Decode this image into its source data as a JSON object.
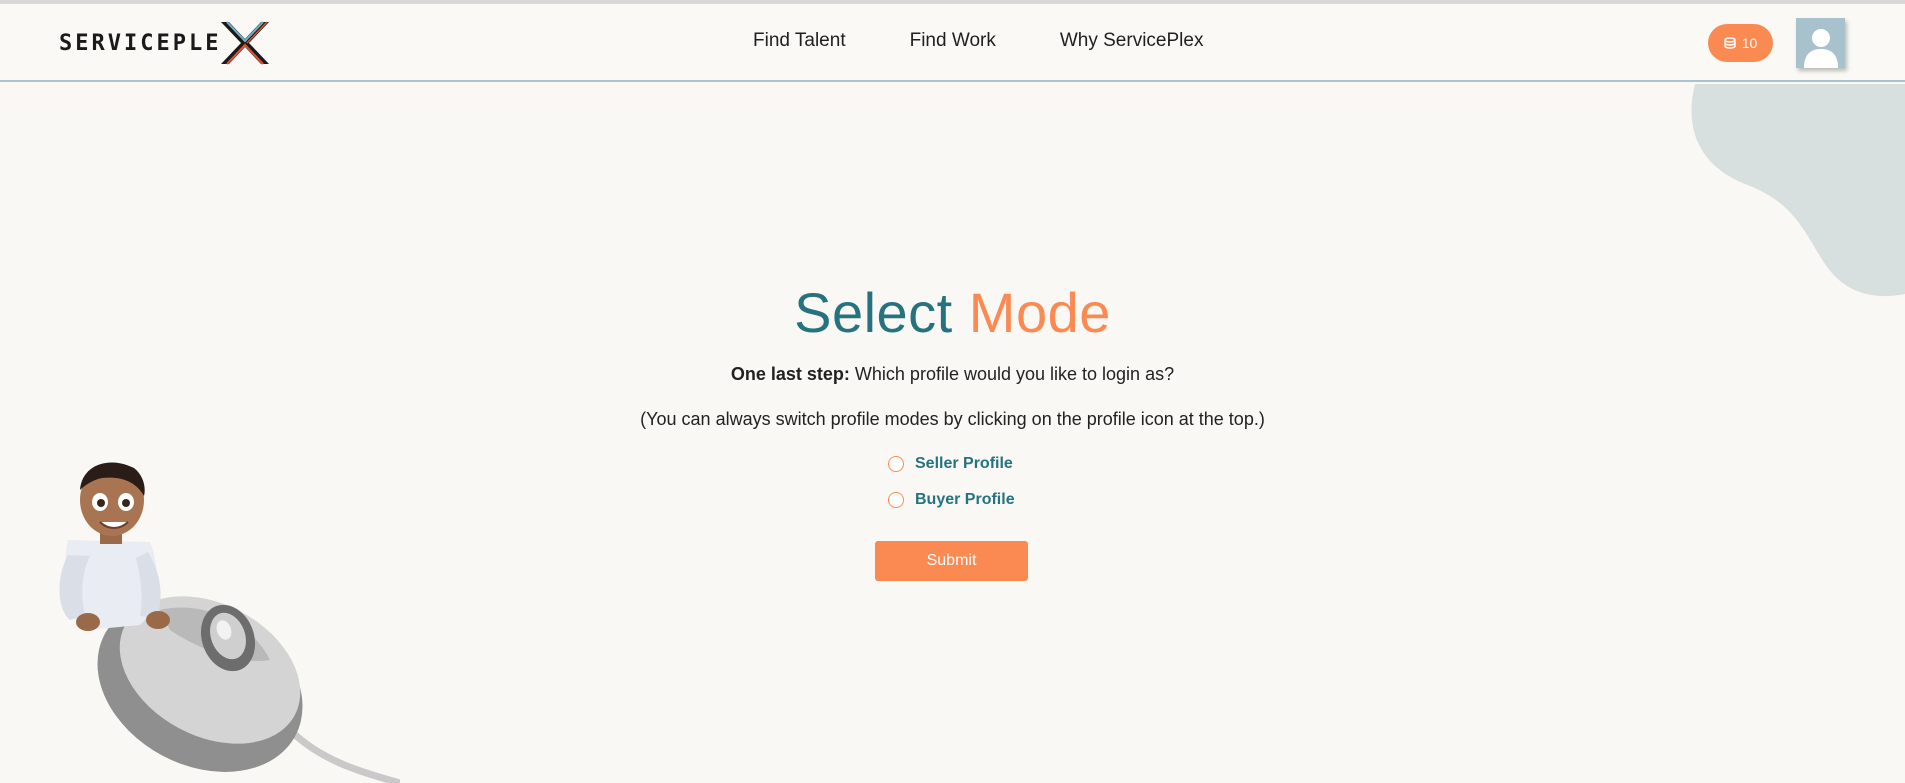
{
  "header": {
    "logo_text": "SERVICEPLE",
    "nav": [
      "Find Talent",
      "Find Work",
      "Why ServicePlex"
    ],
    "coins": {
      "count": "10",
      "icon": "coins-icon"
    },
    "avatar_icon": "user-avatar-icon"
  },
  "main": {
    "title_part1": "Select",
    "title_part2": "Mode",
    "subtitle_bold": "One last step:",
    "subtitle_rest": " Which profile would you like to login as?",
    "hint": "(You can always switch profile modes by clicking on the profile icon at the top.)",
    "options": [
      "Seller Profile",
      "Buyer Profile"
    ],
    "submit_label": "Submit"
  },
  "colors": {
    "teal": "#26737f",
    "orange": "#fb8a52",
    "background": "#f9f8f4",
    "avatar_bg": "#a8c2cd"
  }
}
